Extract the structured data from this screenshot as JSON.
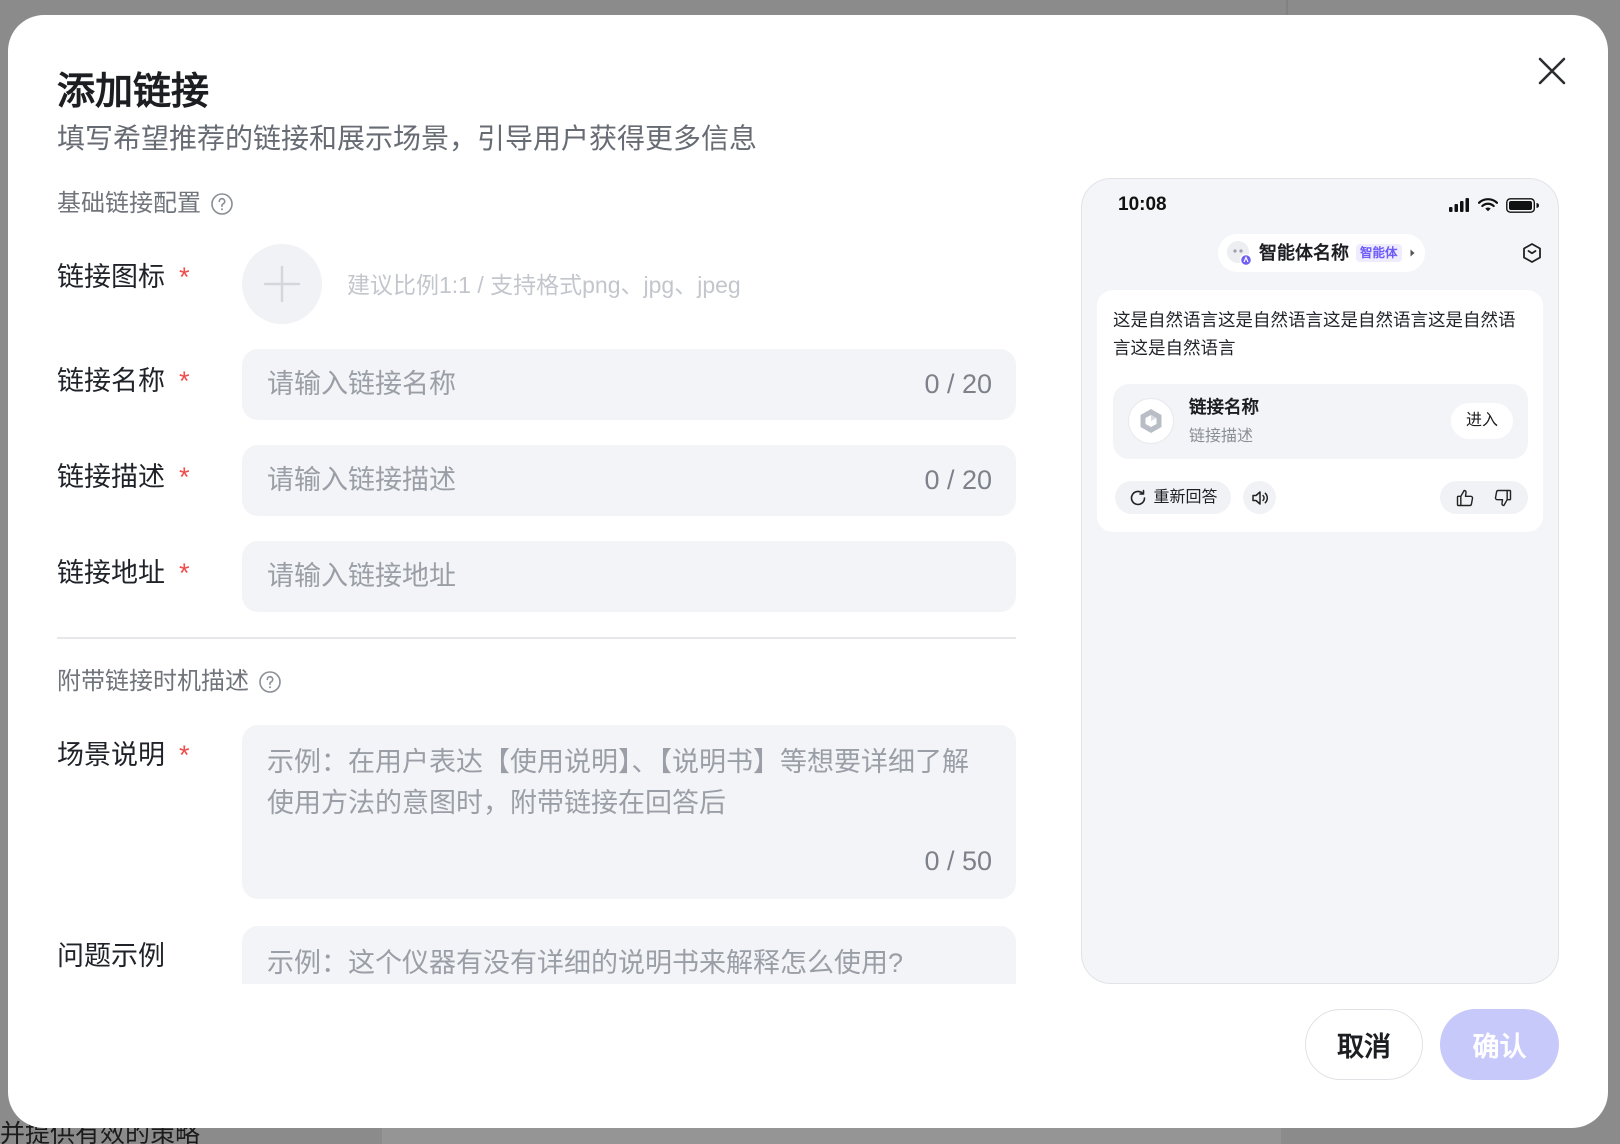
{
  "theme": {
    "overlay": "#8b8b8b",
    "accent": "#6e5cf6",
    "required": "#f04c4c",
    "confirm_bg": "#c6c9fa"
  },
  "background": {
    "bottom_text": "并提供有效的策略"
  },
  "dialog": {
    "title": "添加链接",
    "subtitle": "填写希望推荐的链接和展示场景，引导用户获得更多信息",
    "close_icon": "close-icon"
  },
  "basic": {
    "section_label": "基础链接配置",
    "help_icon": "question-circle-icon",
    "icon_field": {
      "label": "链接图标",
      "required_mark": "*",
      "upload_icon": "plus-icon",
      "hint": "建议比例1:1 / 支持格式png、jpg、jpeg"
    },
    "name_field": {
      "label": "链接名称",
      "required_mark": "*",
      "value": "",
      "placeholder": "请输入链接名称",
      "counter": "0 / 20"
    },
    "desc_field": {
      "label": "链接描述",
      "required_mark": "*",
      "value": "",
      "placeholder": "请输入链接描述",
      "counter": "0 / 20"
    },
    "url_field": {
      "label": "链接地址",
      "required_mark": "*",
      "value": "",
      "placeholder": "请输入链接地址"
    }
  },
  "timing": {
    "section_label": "附带链接时机描述",
    "help_icon": "question-circle-icon",
    "scene_field": {
      "label": "场景说明",
      "required_mark": "*",
      "value": "",
      "placeholder": "示例：在用户表达【使用说明】、【说明书】等想要详细了解使用方法的意图时，附带链接在回答后",
      "counter": "0 / 50"
    },
    "question_field": {
      "label": "问题示例",
      "value": "",
      "placeholder": "示例：这个仪器有没有详细的说明书来解释怎么使用?"
    }
  },
  "preview": {
    "status_bar": {
      "time": "10:08",
      "icons": [
        "signal-icon",
        "wifi-icon",
        "battery-icon"
      ]
    },
    "agent": {
      "name": "智能体名称",
      "tag": "智能体",
      "avatar_icon": "agent-avatar-icon",
      "chevron_icon": "chevron-right-icon"
    },
    "corner_icon": "cube-icon",
    "message": "这是自然语言这是自然语言这是自然语言这是自然语言这是自然语言",
    "link_card": {
      "icon": "link-logo-icon",
      "name": "链接名称",
      "description": "链接描述",
      "enter_label": "进入"
    },
    "actions": {
      "regenerate_label": "重新回答",
      "icons": [
        "refresh-icon",
        "speaker-icon",
        "thumbs-up-icon",
        "thumbs-down-icon"
      ]
    }
  },
  "footer": {
    "cancel_label": "取消",
    "confirm_label": "确认"
  }
}
